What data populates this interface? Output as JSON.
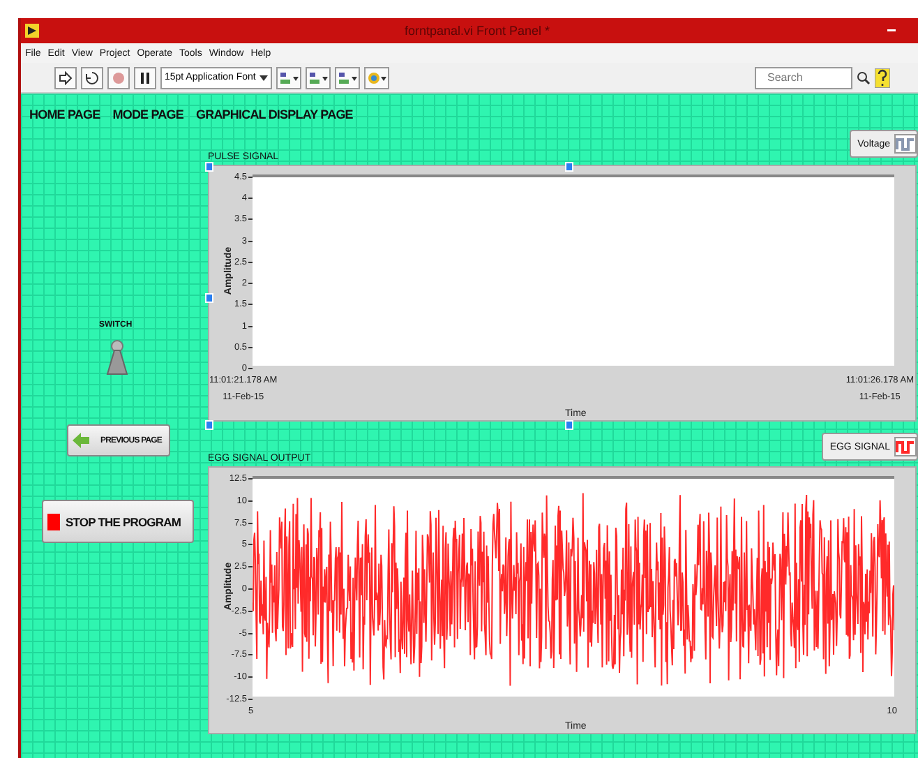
{
  "window": {
    "title": "forntpanal.vi Front Panel *"
  },
  "menu": [
    "File",
    "Edit",
    "View",
    "Project",
    "Operate",
    "Tools",
    "Window",
    "Help"
  ],
  "toolbar": {
    "font": "15pt Application Font",
    "search": {
      "placeholder": "Search"
    }
  },
  "nav": [
    "HOME PAGE",
    "MODE PAGE",
    "GRAPHICAL DISPLAY PAGE"
  ],
  "switch": {
    "label": "SWITCH",
    "on": false
  },
  "buttons": [
    {
      "kind": "previous",
      "label": "PREVIOUS PAGE"
    },
    {
      "kind": "stop",
      "label": "STOP THE PROGRAM"
    }
  ],
  "graphs": [
    {
      "kind": "empty",
      "title": "PULSE SIGNAL",
      "legend": "Voltage",
      "color": "#8a98b0",
      "y_label": "Amplitude",
      "x_label": "Time",
      "y_ticks": [
        "4.5",
        "4",
        "3.5",
        "3",
        "2.5",
        "2",
        "1.5",
        "1",
        "0.5",
        "0"
      ],
      "x_ticks": [
        [
          "11:01:21.178 AM",
          "11-Feb-15"
        ],
        [
          "11:01:26.178 AM",
          "11-Feb-15"
        ]
      ],
      "selected": true
    },
    {
      "kind": "noise",
      "title": "EGG SIGNAL OUTPUT",
      "legend": "EGG SIGNAL",
      "color": "#ff2a2a",
      "y_label": "Amplitude",
      "x_label": "Time",
      "y_ticks": [
        "12.5",
        "10",
        "7.5",
        "5",
        "2.5",
        "0",
        "-2.5",
        "-5",
        "-7.5",
        "-10",
        "-12.5"
      ],
      "x_ticks": [
        [
          "5"
        ],
        [
          "10"
        ]
      ],
      "selected": false
    }
  ]
}
